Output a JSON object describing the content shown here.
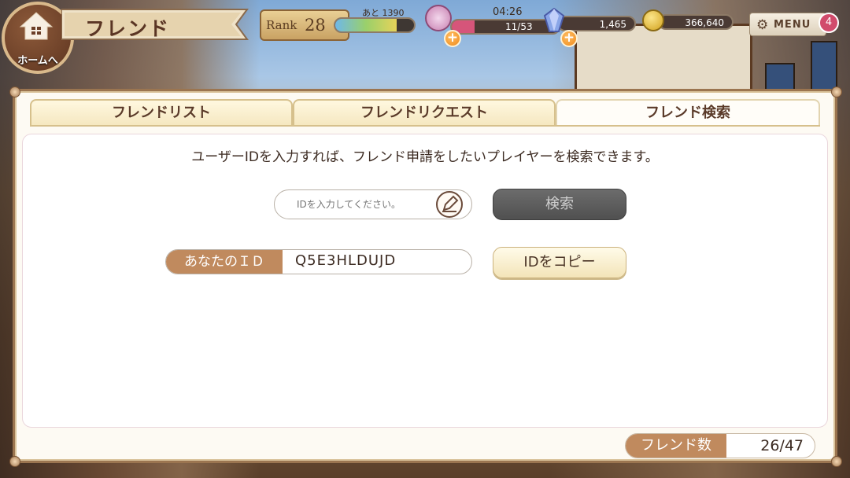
{
  "header": {
    "home_label": "ホームへ",
    "title": "フレンド",
    "rank_label": "Rank",
    "rank_value": "28",
    "exp_text": "あと 1390",
    "exp_progress": 0.78,
    "stamina_time": "04:26",
    "stamina_text": "11/53",
    "stamina_progress": 0.21,
    "gems": "1,465",
    "coins": "366,640",
    "menu_label": "MENU",
    "menu_badge": "4"
  },
  "tabs": [
    {
      "label": "フレンドリスト",
      "active": false
    },
    {
      "label": "フレンドリクエスト",
      "active": false
    },
    {
      "label": "フレンド検索",
      "active": true
    }
  ],
  "search": {
    "description": "ユーザーIDを入力すれば、フレンド申請をしたいプレイヤーを検索できます。",
    "placeholder": "IDを入力してください。",
    "value": "",
    "button_label": "検索"
  },
  "your_id": {
    "label": "あなたのＩＤ",
    "value": "Q5E3HLDUJD",
    "copy_label": "IDをコピー"
  },
  "friend_count": {
    "label": "フレンド数",
    "value": "26/47"
  },
  "colors": {
    "accent_brown": "#c08a5e",
    "panel_border": "#9b7550",
    "search_button": "#5c5c5c",
    "stamina": "#d6557a"
  }
}
